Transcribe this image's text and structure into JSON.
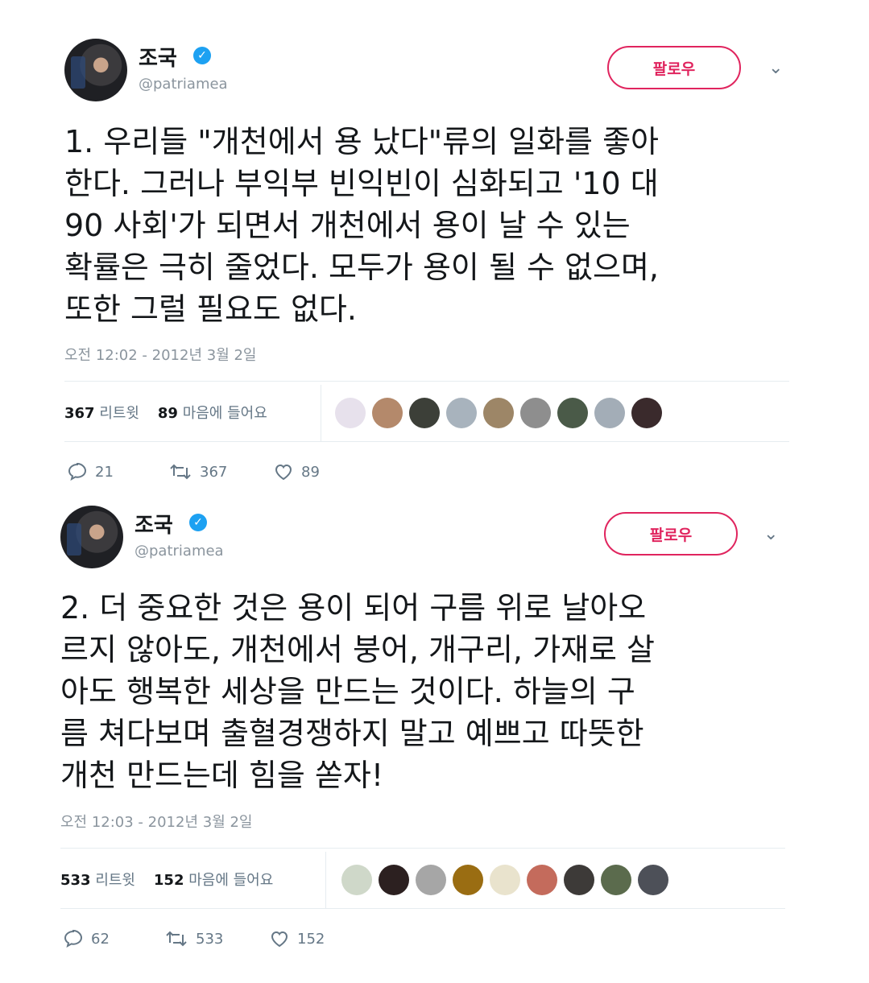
{
  "tweets": [
    {
      "display_name": "조국",
      "handle": "@patriamea",
      "follow_label": "팔로우",
      "text": "1. 우리들 \"개천에서 용 났다\"류의 일화를 좋아\n한다. 그러나 부익부 빈익빈이 심화되고 '10 대\n90 사회'가 되면서 개천에서 용이 날 수 있는\n확률은 극히 줄었다. 모두가 용이 될 수 없으며,\n또한 그럴 필요도 없다.",
      "timestamp": "오전 12:02 - 2012년 3월 2일",
      "retweets_count": "367",
      "retweets_label": "리트윗",
      "likes_count": "89",
      "likes_label": "마음에 들어요",
      "likers": [
        "#e7e1ec",
        "#b4896b",
        "#3c3f38",
        "#a8b3bd",
        "#9d8667",
        "#8e8e8e",
        "#4a5a48",
        "#a3adb7",
        "#3a2a2c"
      ],
      "reply_count": "21",
      "retweet_count": "367",
      "like_count": "89"
    },
    {
      "display_name": "조국",
      "handle": "@patriamea",
      "follow_label": "팔로우",
      "text": "2. 더 중요한 것은 용이 되어 구름 위로 날아오\n르지 않아도, 개천에서 붕어, 개구리, 가재로 살\n아도 행복한 세상을 만드는 것이다. 하늘의 구\n름 쳐다보며 출혈경쟁하지 말고 예쁘고 따뜻한\n개천 만드는데 힘을 쏟자!",
      "timestamp": "오전 12:03 - 2012년 3월 2일",
      "retweets_count": "533",
      "retweets_label": "리트윗",
      "likes_count": "152",
      "likes_label": "마음에 들어요",
      "likers": [
        "#cfd8c9",
        "#2c2020",
        "#a6a6a6",
        "#9a6d12",
        "#e9e3cd",
        "#c46b5c",
        "#3d3a38",
        "#5b6b4d",
        "#4d5058"
      ],
      "reply_count": "62",
      "retweet_count": "533",
      "like_count": "152"
    }
  ],
  "colors": {
    "follow": "#e0245e",
    "verified": "#1da1f2",
    "secondary_text": "#8b959e"
  }
}
